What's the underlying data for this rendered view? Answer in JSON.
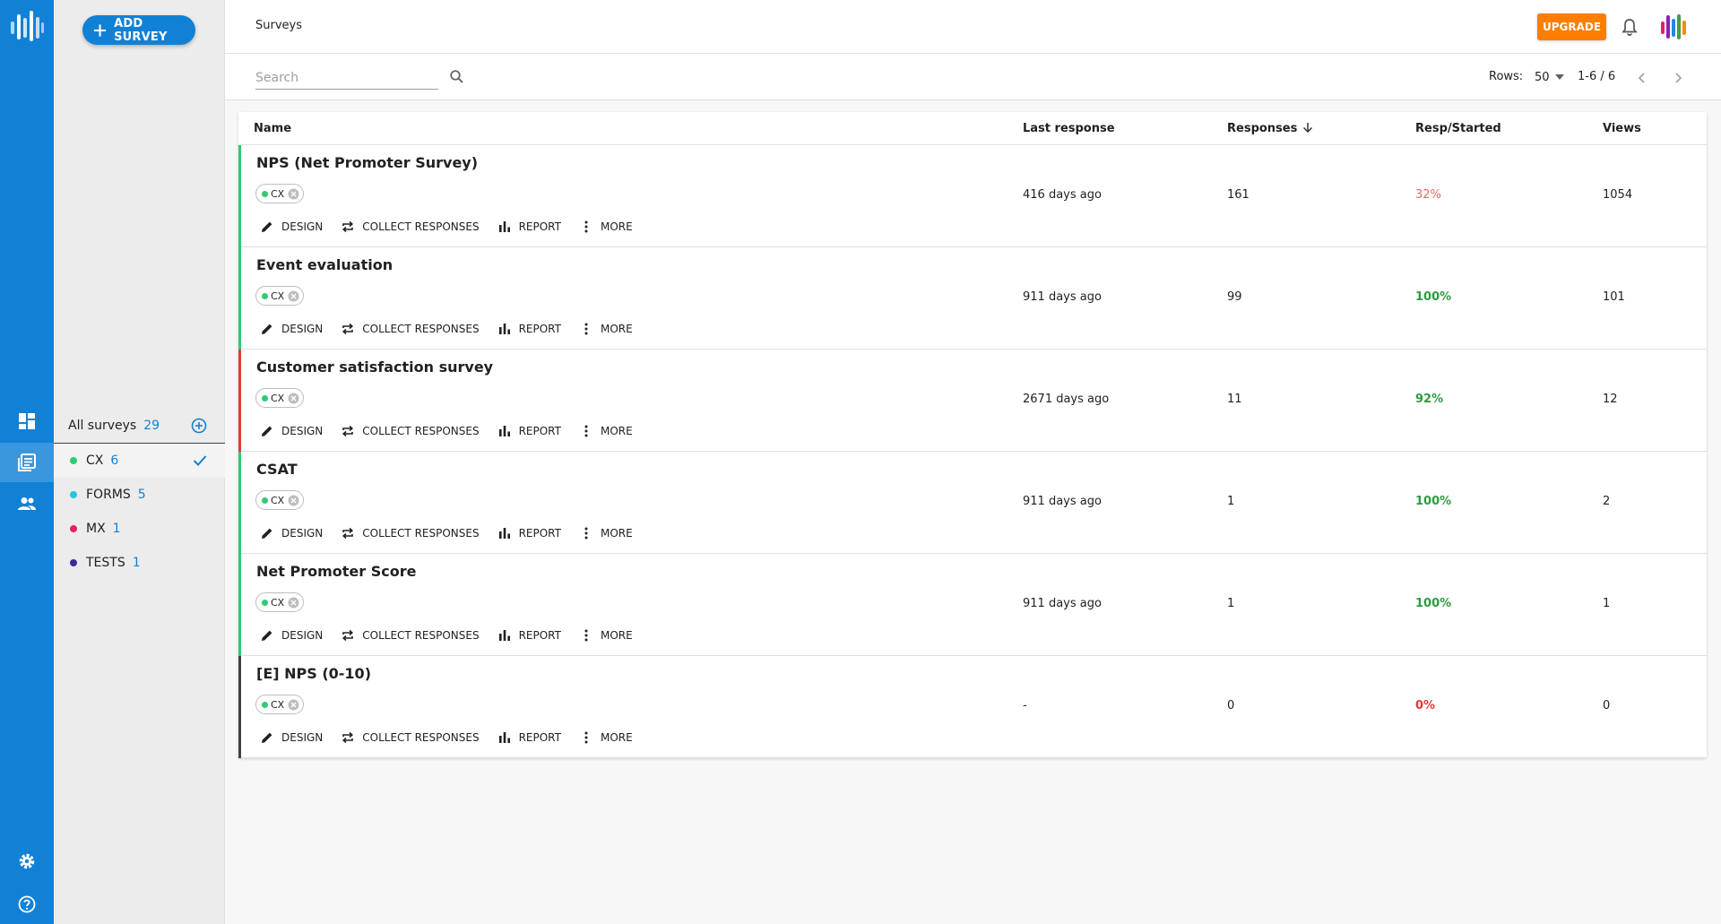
{
  "app": {
    "page_title": "Surveys",
    "add_survey_label": "ADD SURVEY",
    "upgrade_label": "UPGRADE"
  },
  "rail": {
    "icons": [
      "logo-icon",
      "dashboard-icon",
      "surveys-icon",
      "people-icon",
      "settings-icon",
      "help-icon"
    ],
    "accent": "#1181d6"
  },
  "sidebar": {
    "all_label": "All surveys",
    "all_count": "29",
    "folders": [
      {
        "label": "CX",
        "count": "6",
        "color": "#2ecc71",
        "selected": true
      },
      {
        "label": "FORMS",
        "count": "5",
        "color": "#26c6da"
      },
      {
        "label": "MX",
        "count": "1",
        "color": "#e91e63"
      },
      {
        "label": "TESTS",
        "count": "1",
        "color": "#3f2b96"
      }
    ]
  },
  "toolbar": {
    "search_placeholder": "Search",
    "rows_label": "Rows:",
    "rows_value": "50",
    "range": "1-6 / 6"
  },
  "table": {
    "headers": {
      "name": "Name",
      "last_response": "Last response",
      "responses": "Responses",
      "resp_started": "Resp/Started",
      "views": "Views"
    },
    "action_labels": {
      "design": "DESIGN",
      "collect": "COLLECT RESPONSES",
      "report": "REPORT",
      "more": "MORE"
    },
    "rows": [
      {
        "name": "NPS (Net Promoter Survey)",
        "tag": "CX",
        "last_response": "416 days ago",
        "responses": "161",
        "resp_started": "32%",
        "views": "1054",
        "stripe": "#2ecc71",
        "pct_style": "low"
      },
      {
        "name": "Event evaluation",
        "tag": "CX",
        "last_response": "911 days ago",
        "responses": "99",
        "resp_started": "100%",
        "views": "101",
        "stripe": "#2ecc71",
        "pct_style": "ok"
      },
      {
        "name": "Customer satisfaction survey",
        "tag": "CX",
        "last_response": "2671 days ago",
        "responses": "11",
        "resp_started": "92%",
        "views": "12",
        "stripe": "#e53935",
        "pct_style": "ok"
      },
      {
        "name": "CSAT",
        "tag": "CX",
        "last_response": "911 days ago",
        "responses": "1",
        "resp_started": "100%",
        "views": "2",
        "stripe": "#2ecc71",
        "pct_style": "ok"
      },
      {
        "name": "Net Promoter Score",
        "tag": "CX",
        "last_response": "911 days ago",
        "responses": "1",
        "resp_started": "100%",
        "views": "1",
        "stripe": "#2ecc71",
        "pct_style": "ok"
      },
      {
        "name": "[E] NPS (0-10)",
        "tag": "CX",
        "last_response": "-",
        "responses": "0",
        "resp_started": "0%",
        "views": "0",
        "stripe": "#424242",
        "pct_style": "zero"
      }
    ]
  }
}
